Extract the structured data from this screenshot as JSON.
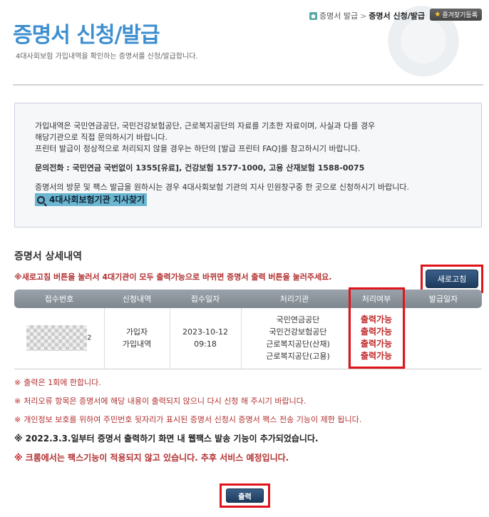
{
  "header": {
    "title": "증명서 신청/발급",
    "description": "4대사회보험 가입내역을 확인하는 증명서를 신청/발급합니다.",
    "breadcrumb": {
      "parent": "증명서 발급",
      "separator": ">",
      "current": "증명서 신청/발급"
    },
    "favorites_label": "즐겨찾기등록"
  },
  "info": {
    "line1": "가입내역은 국민연금공단, 국민건강보험공단, 근로복지공단의 자료를 기초한 자료이며, 사실과 다를 경우",
    "line2": "해당기관으로 직접 문의하시기 바랍니다.",
    "line3": "프린터 발급이 정상적으로 처리되지 않을 경우는 하단의 [발급 프린터 FAQ]를 참고하시기 바랍니다.",
    "contact": "문의전화 : 국민연금 국번없이 1355[유료], 건강보험 1577-1000, 고용 산재보험 1588-0075",
    "line4": "증명서의 방문 및 팩스 발급을 원하시는 경우 4대사회보험 기관의 지사 민원창구중 한 곳으로 신청하시기 바랍니다.",
    "branch_link": "4대사회보험기관 지사찾기"
  },
  "details": {
    "section_title": "증명서 상세내역",
    "notice": "※새로고침 버튼을 눌러서 4대기관이 모두 출력가능으로 바뀌면 증명서 출력 버튼을 눌러주세요.",
    "refresh_label": "새로고침",
    "columns": [
      "접수번호",
      "신청내역",
      "접수일자",
      "처리기관",
      "처리여부",
      "발급일자"
    ],
    "row": {
      "id_suffix": "2",
      "request_line1": "가입자",
      "request_line2": "가입내역",
      "date": "2023-10-12",
      "time": "09:18",
      "agencies": [
        "국민연금공단",
        "국민건강보험공단",
        "근로복지공단(산재)",
        "근로복지공단(고용)"
      ],
      "statuses": [
        "출력가능",
        "출력가능",
        "출력가능",
        "출력가능"
      ],
      "issue_date": ""
    }
  },
  "notes": {
    "mark": "※",
    "n1": "출력은 1회에 한합니다.",
    "n2": "처리오류 항목은 증명서에 해당 내용이 출력되지 않으니 다시 신청 해 주시기 바랍니다.",
    "n3": "개인정보 보호를 위하여 주민번호 뒷자리가 표시된 증명서 신청시 증명서 팩스 전송 기능이 제한 됩니다.",
    "n4": "2022.3.3.일부터 증명서 출력하기 화면 내 웹팩스 발송 기능이 추가되었습니다.",
    "n5": "크롬에서는 팩스기능이 적용되지 않고 있습니다. 추후 서비스 예정입니다."
  },
  "print_label": "출력"
}
